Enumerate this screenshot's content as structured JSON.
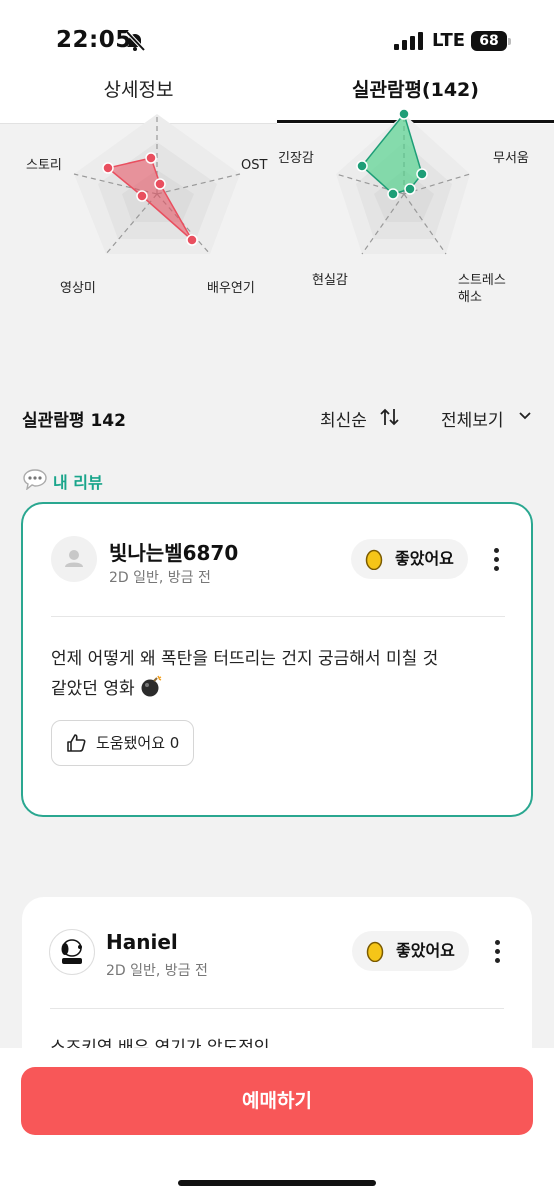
{
  "status_bar": {
    "time": "22:05",
    "network": "LTE",
    "battery": "68"
  },
  "tabs": [
    {
      "label": "상세정보",
      "active": false
    },
    {
      "label": "실관람평(142)",
      "active": true
    }
  ],
  "radar_left": {
    "labels": [
      "OST",
      "배우연기",
      "영상미",
      "스토리"
    ],
    "color": "#e94f5f"
  },
  "radar_right": {
    "labels": [
      "긴장감",
      "무서움",
      "스트레스",
      "해소",
      "현실감"
    ],
    "color": "#1e9e77"
  },
  "summary": {
    "title": "실관람평 142",
    "sort_label": "최신순",
    "filter_label": "전체보기"
  },
  "my_review": {
    "section_label": "내 리뷰",
    "user_name": "빛나는벨6870",
    "meta": "2D 일반, 방금 전",
    "reaction": "좋았어요",
    "text_line1": "언제 어떻게 왜 폭탄을 터뜨리는 건지 궁금해서 미칠 것",
    "text_line2": "같았던 영화",
    "helpful_label": "도움됐어요 0"
  },
  "other_review": {
    "user_name": "Haniel",
    "meta": "2D 일반, 방금 전",
    "reaction": "좋았어요",
    "text_partial": "스즈키역 배우 연기가 압도적인"
  },
  "bottom": {
    "reserve_label": "예매하기"
  },
  "colors": {
    "accent_green": "#2aa790",
    "reserve_red": "#f85758"
  }
}
